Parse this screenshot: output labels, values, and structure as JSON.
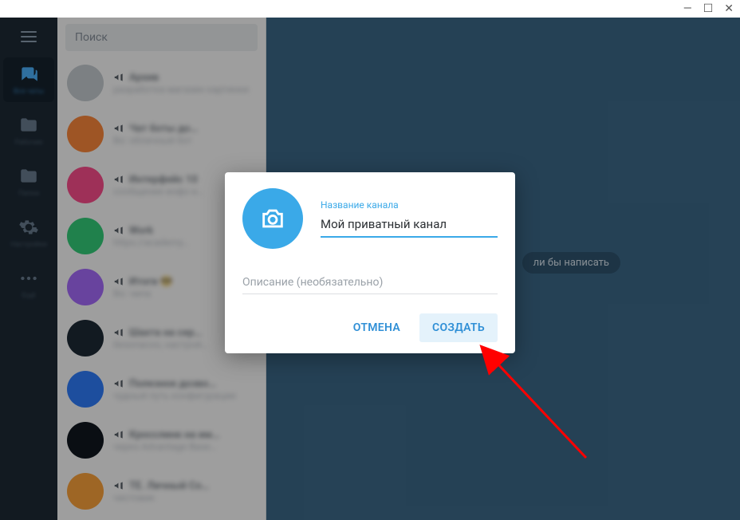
{
  "window": {
    "minimize": "—",
    "maximize": "☐",
    "close": "✕"
  },
  "search": {
    "placeholder": "Поиск"
  },
  "rail": {
    "items": [
      {
        "label": "Все чаты"
      },
      {
        "label": "Рабочие"
      },
      {
        "label": "Папки"
      },
      {
        "label": "Настройки"
      },
      {
        "label": "Ещё"
      }
    ]
  },
  "chats": [
    {
      "color": "#c9cfd4",
      "title": "Архив",
      "sub": "разработка магазин картинки"
    },
    {
      "color": "#ff8a3d",
      "title": "Чат боты до…",
      "sub": "Во: облачный бот"
    },
    {
      "color": "#ff4e8e",
      "title": "Интерфейс 10",
      "sub": "сообщение инфо и…"
    },
    {
      "color": "#34d07b",
      "title": "Work",
      "sub": "https://academy…"
    },
    {
      "color": "#a86cff",
      "title": "Итоги 😎",
      "sub": "Во: чипа"
    },
    {
      "color": "#1e2a36",
      "title": "Шахта на сер…",
      "sub": "безопасно, настрой…"
    },
    {
      "color": "#2f7fff",
      "title": "Полезное дозво…",
      "sub": "чудный путь конфигурации"
    },
    {
      "color": "#111820",
      "title": "Кросслинк на им…",
      "sub": "через Advantage Base…"
    },
    {
      "color": "#ffa53d",
      "title": "ТЕ. Личный Co…",
      "sub": "чистовик"
    }
  ],
  "chip": {
    "text": "ли бы написать"
  },
  "modal": {
    "title_label": "Название канала",
    "title_value": "Мой приватный канал",
    "desc_placeholder": "Описание (необязательно)",
    "cancel": "ОТМЕНА",
    "create": "СОЗДАТЬ"
  }
}
